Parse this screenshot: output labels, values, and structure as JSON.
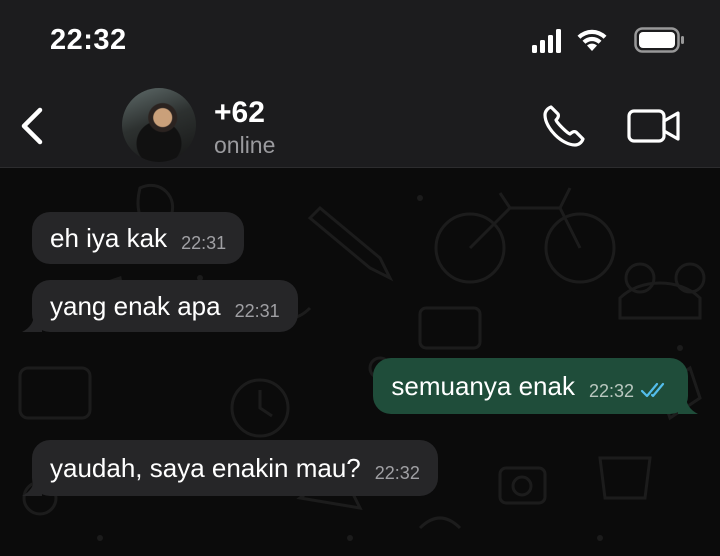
{
  "status_bar": {
    "time": "22:32"
  },
  "header": {
    "contact_name": "+62",
    "contact_status": "online"
  },
  "messages": [
    {
      "direction": "incoming",
      "text": "eh iya kak",
      "time": "22:31"
    },
    {
      "direction": "incoming",
      "text": "yang enak apa",
      "time": "22:31"
    },
    {
      "direction": "outgoing",
      "text": "semuanya enak",
      "time": "22:32",
      "read": true
    },
    {
      "direction": "incoming",
      "text": "yaudah, saya enakin mau?",
      "time": "22:32"
    }
  ],
  "colors": {
    "incoming_bubble": "#262628",
    "outgoing_bubble": "#1f4d3a",
    "read_ticks": "#53bdeb",
    "header_bg": "#1c1c1e"
  },
  "icons": [
    "signal-icon",
    "wifi-icon",
    "battery-icon",
    "back-icon",
    "phone-icon",
    "video-camera-icon",
    "double-check-icon"
  ]
}
